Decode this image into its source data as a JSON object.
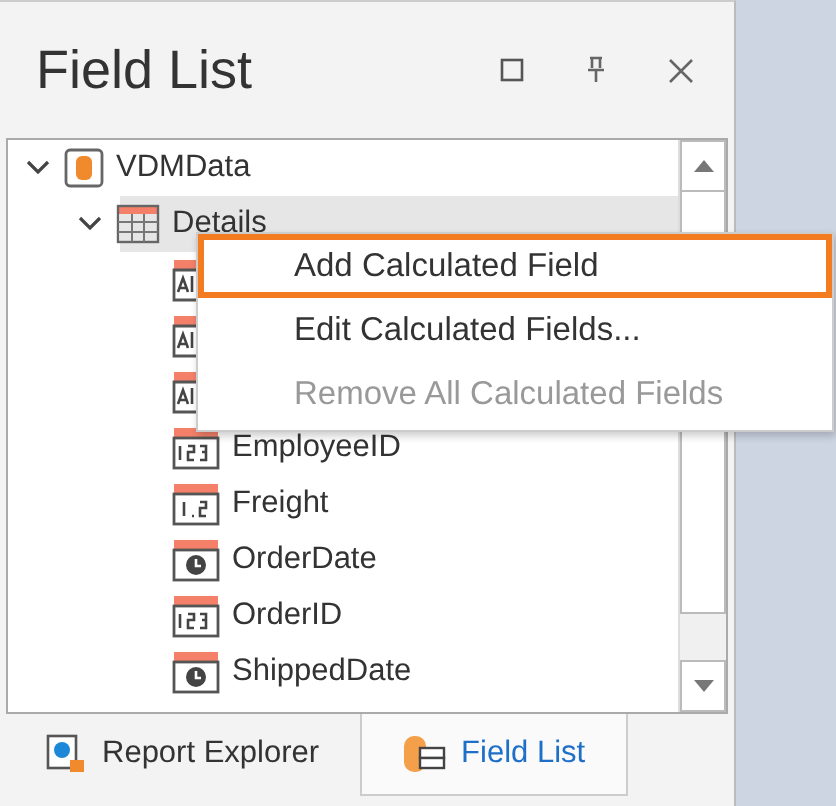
{
  "panel": {
    "title": "Field List"
  },
  "tree": [
    {
      "label": "VDMData",
      "kind": "source",
      "expanded": true,
      "selected": false,
      "children": [
        {
          "label": "Details",
          "kind": "table",
          "expanded": true,
          "selected": true,
          "children": [
            {
              "kind": "text"
            },
            {
              "kind": "text"
            },
            {
              "kind": "text"
            },
            {
              "label": "EmployeeID",
              "kind": "number"
            },
            {
              "label": "Freight",
              "kind": "decimal"
            },
            {
              "label": "OrderDate",
              "kind": "date"
            },
            {
              "label": "OrderID",
              "kind": "number"
            },
            {
              "label": "ShippedDate",
              "kind": "date"
            }
          ]
        }
      ]
    }
  ],
  "context_menu": [
    {
      "label": "Add Calculated Field",
      "selected": true,
      "disabled": false
    },
    {
      "label": "Edit Calculated Fields...",
      "selected": false,
      "disabled": false
    },
    {
      "label": "Remove All Calculated Fields",
      "selected": false,
      "disabled": true
    }
  ],
  "tabs": [
    {
      "label": "Report Explorer",
      "kind": "explorer",
      "selected": false
    },
    {
      "label": "Field List",
      "kind": "fields",
      "selected": true
    }
  ]
}
